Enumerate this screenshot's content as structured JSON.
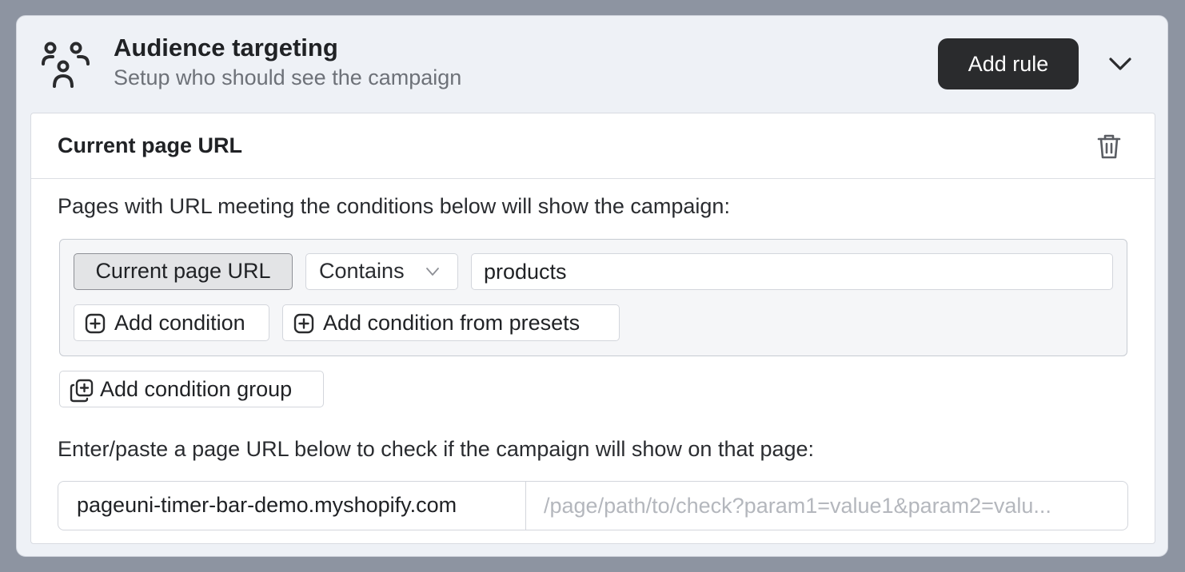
{
  "header": {
    "icon": "audience-icon",
    "title": "Audience targeting",
    "subtitle": "Setup who should see the campaign",
    "add_rule_label": "Add rule",
    "collapse_icon": "chevron-down-icon"
  },
  "rule": {
    "title": "Current page URL",
    "delete_icon": "trash-icon",
    "description": "Pages with URL meeting the conditions below will show the campaign:",
    "conditions": [
      {
        "field": "Current page URL",
        "operator": "Contains",
        "value": "products"
      }
    ],
    "add_condition_label": "Add condition",
    "add_condition_presets_label": "Add condition from presets",
    "add_condition_group_label": "Add condition group"
  },
  "url_check": {
    "description": "Enter/paste a page URL below to check if the campaign will show on that page:",
    "domain": "pageuni-timer-bar-demo.myshopify.com",
    "path_value": "",
    "path_placeholder": "/page/path/to/check?param1=value1&param2=valu..."
  },
  "colors": {
    "primary_button": "#2a2b2d",
    "panel_bg": "#eef1f6",
    "page_bg": "#8d94a1"
  }
}
